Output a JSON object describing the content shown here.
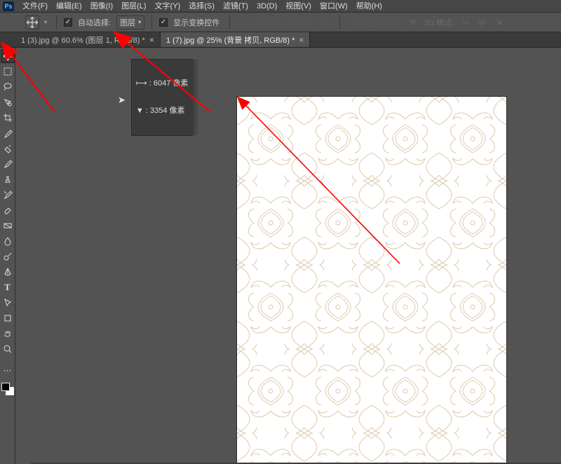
{
  "menubar": {
    "logo_text": "Ps",
    "items": [
      {
        "label": "文件(F)"
      },
      {
        "label": "编辑(E)"
      },
      {
        "label": "图像(I)"
      },
      {
        "label": "图层(L)"
      },
      {
        "label": "文字(Y)"
      },
      {
        "label": "选择(S)"
      },
      {
        "label": "滤镜(T)"
      },
      {
        "label": "3D(D)"
      },
      {
        "label": "视图(V)"
      },
      {
        "label": "窗口(W)"
      },
      {
        "label": "帮助(H)"
      }
    ]
  },
  "optionsbar": {
    "auto_select_label": "自动选择:",
    "auto_select_target": "图层",
    "show_transform_label": "显示变换控件",
    "mode_3d_label": "3D 模式:"
  },
  "tabs": [
    {
      "label": "1 (3).jpg @ 60.6% (图层 1, RGB/8) *",
      "active": false
    },
    {
      "label": "1 (7).jpg @ 25% (背景 拷贝, RGB/8) *",
      "active": true
    }
  ],
  "coord_tip": {
    "line1": "⟼ : 6047 像素",
    "line2": "▼ : 3354 像素"
  },
  "tools": [
    {
      "name": "move-tool-icon",
      "title": "移动",
      "active": true
    },
    {
      "name": "marquee-tool-icon",
      "title": "矩形选框"
    },
    {
      "name": "lasso-tool-icon",
      "title": "套索"
    },
    {
      "name": "quick-select-tool-icon",
      "title": "快速选择"
    },
    {
      "name": "crop-tool-icon",
      "title": "裁剪"
    },
    {
      "name": "eyedropper-tool-icon",
      "title": "吸管"
    },
    {
      "name": "healing-tool-icon",
      "title": "修复"
    },
    {
      "name": "brush-tool-icon",
      "title": "画笔"
    },
    {
      "name": "stamp-tool-icon",
      "title": "仿制图章"
    },
    {
      "name": "history-brush-tool-icon",
      "title": "历史记录画笔"
    },
    {
      "name": "eraser-tool-icon",
      "title": "橡皮擦"
    },
    {
      "name": "gradient-tool-icon",
      "title": "渐变"
    },
    {
      "name": "blur-tool-icon",
      "title": "模糊"
    },
    {
      "name": "dodge-tool-icon",
      "title": "减淡"
    },
    {
      "name": "pen-tool-icon",
      "title": "钢笔"
    },
    {
      "name": "type-tool-icon",
      "title": "文字"
    },
    {
      "name": "path-select-tool-icon",
      "title": "路径选择"
    },
    {
      "name": "shape-tool-icon",
      "title": "形状"
    },
    {
      "name": "hand-tool-icon",
      "title": "抓手"
    },
    {
      "name": "zoom-tool-icon",
      "title": "缩放"
    }
  ],
  "colors": {
    "accent_red": "#ff0000",
    "ui_dark": "#474747",
    "ui_mid": "#535353",
    "ui_darker": "#3a3a3a",
    "pattern_tint": "#d9c4a4"
  }
}
